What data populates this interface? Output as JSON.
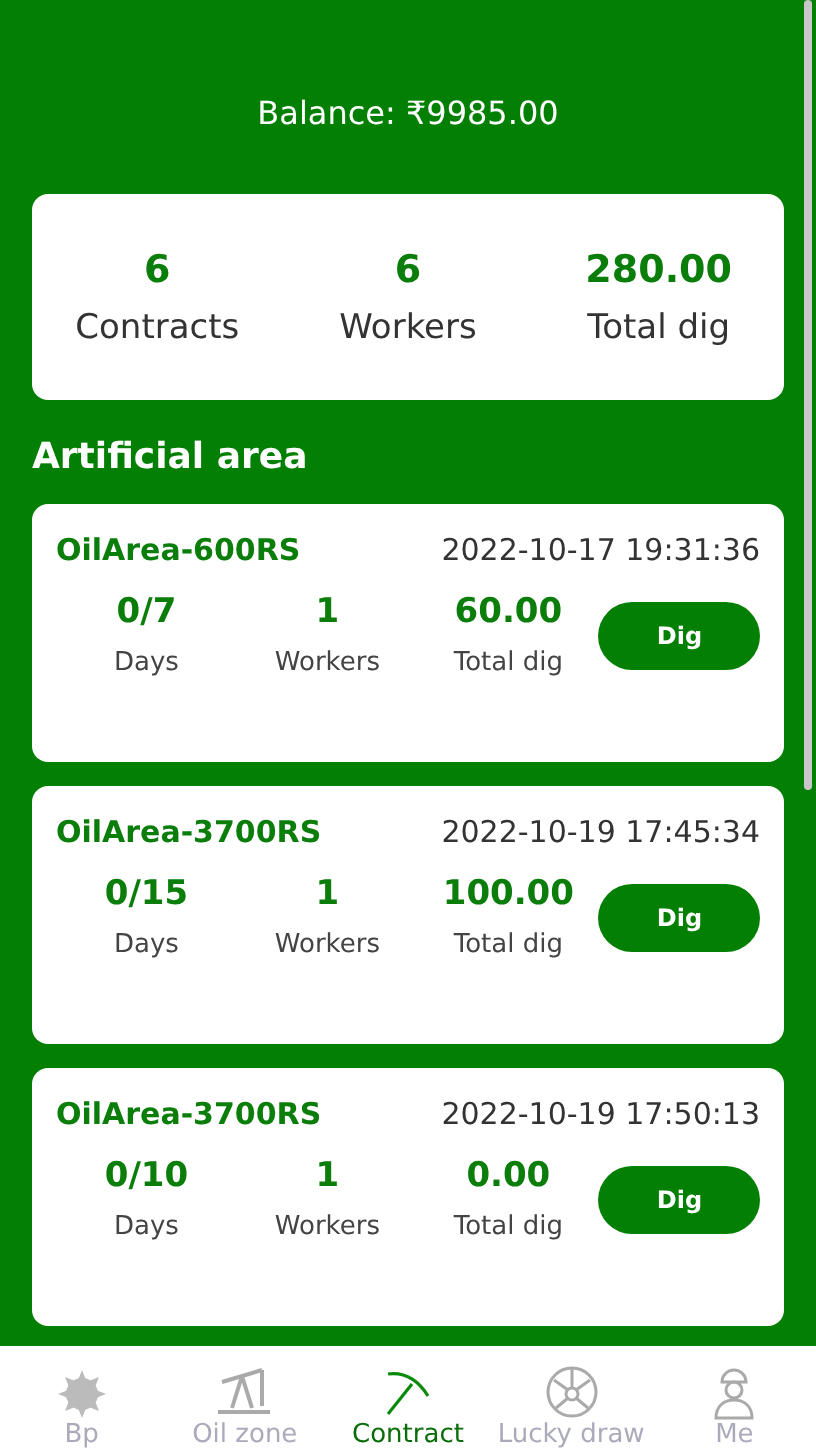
{
  "balance": "Balance: ₹9985.00",
  "summary": [
    {
      "value": "6",
      "label": "Contracts"
    },
    {
      "value": "6",
      "label": "Workers"
    },
    {
      "value": "280.00",
      "label": "Total dig"
    }
  ],
  "section_title": "Artificial area",
  "contracts": [
    {
      "name": "OilArea-600RS",
      "time": "2022-10-17 19:31:36",
      "stats": [
        {
          "value": "0/7",
          "label": "Days"
        },
        {
          "value": "1",
          "label": "Workers"
        },
        {
          "value": "60.00",
          "label": "Total dig"
        }
      ],
      "button": "Dig"
    },
    {
      "name": "OilArea-3700RS",
      "time": "2022-10-19 17:45:34",
      "stats": [
        {
          "value": "0/15",
          "label": "Days"
        },
        {
          "value": "1",
          "label": "Workers"
        },
        {
          "value": "100.00",
          "label": "Total dig"
        }
      ],
      "button": "Dig"
    },
    {
      "name": "OilArea-3700RS",
      "time": "2022-10-19 17:50:13",
      "stats": [
        {
          "value": "0/10",
          "label": "Days"
        },
        {
          "value": "1",
          "label": "Workers"
        },
        {
          "value": "0.00",
          "label": "Total dig"
        }
      ],
      "button": "Dig"
    }
  ],
  "nav": [
    {
      "kind": "sun",
      "label": "Bp",
      "selected": false
    },
    {
      "kind": "pump",
      "label": "Oil zone",
      "selected": false
    },
    {
      "kind": "pickaxe",
      "label": "Contract",
      "selected": true
    },
    {
      "kind": "wheel",
      "label": "Lucky draw",
      "selected": false
    },
    {
      "kind": "worker",
      "label": "Me",
      "selected": false
    }
  ]
}
